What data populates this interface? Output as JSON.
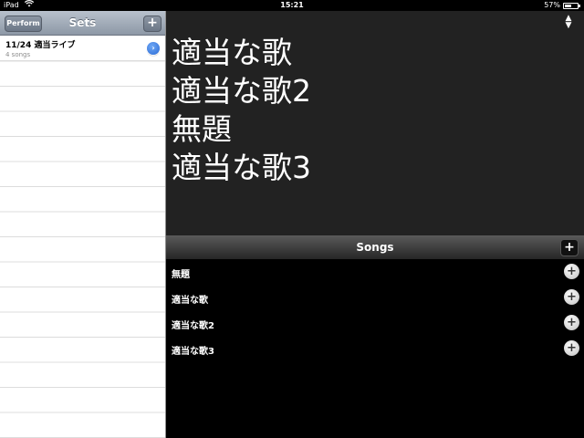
{
  "status_bar": {
    "carrier": "iPad",
    "time": "15:21",
    "battery_text": "57%",
    "battery_level": 0.57
  },
  "sets_panel": {
    "title": "Sets",
    "perform_label": "Perform",
    "add_label": "+",
    "items": [
      {
        "title": "11/24 適当ライブ",
        "subtitle": "4 songs"
      }
    ]
  },
  "lyrics": {
    "lines": [
      "適当な歌",
      "適当な歌2",
      "無題",
      "適当な歌3"
    ]
  },
  "songs_panel": {
    "title": "Songs",
    "add_label": "+",
    "items": [
      {
        "label": "無題"
      },
      {
        "label": "適当な歌"
      },
      {
        "label": "適当な歌2"
      },
      {
        "label": "適当な歌3"
      }
    ]
  },
  "icons": {
    "wifi": "wifi-icon",
    "battery": "battery-icon",
    "disclosure": "chevron-right-icon",
    "sort": "sort-icon",
    "add": "plus-icon"
  },
  "colors": {
    "nav_bar": "#9aa4b1",
    "disclosure": "#2a6ad6",
    "lyrics_bg": "#222222"
  }
}
